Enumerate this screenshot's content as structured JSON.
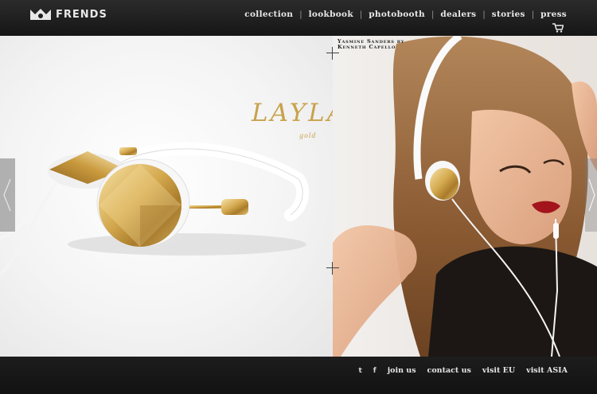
{
  "header": {
    "brand": "FRENDS",
    "nav": [
      "collection",
      "lookbook",
      "photobooth",
      "dealers",
      "stories",
      "press"
    ],
    "separator": "|",
    "cart_icon": "cart-icon"
  },
  "hero": {
    "product_name": "LAYLA",
    "product_color": "gold",
    "credit_line1": "Yasmine Sanders by",
    "credit_line2": "Kenneth Capello",
    "accent_color": "#c8a24c"
  },
  "footer": {
    "social": [
      "t",
      "f"
    ],
    "links": [
      "join us",
      "contact us",
      "visit EU",
      "visit ASIA"
    ]
  }
}
